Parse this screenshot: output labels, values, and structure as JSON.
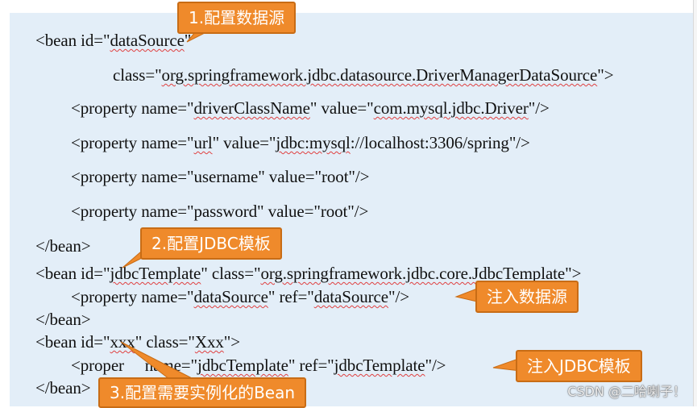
{
  "lines": [
    {
      "id": "l1",
      "segments": [
        {
          "t": "<bean id=\""
        },
        {
          "t": "dataSource",
          "sq": true
        },
        {
          "t": "\""
        }
      ]
    },
    {
      "id": "l2",
      "segments": [
        {
          "t": "class=\""
        },
        {
          "t": "org.springframework.jdbc.datasource.DriverManagerDataSource",
          "sq": true
        },
        {
          "t": "\">"
        }
      ]
    },
    {
      "id": "l3",
      "segments": [
        {
          "t": "<property name=\""
        },
        {
          "t": "driverClassName",
          "sq": true
        },
        {
          "t": "\" value=\""
        },
        {
          "t": "com.mysql.jdbc.Driver",
          "sq": true
        },
        {
          "t": "\"/>"
        }
      ]
    },
    {
      "id": "l4",
      "segments": [
        {
          "t": "<property name=\""
        },
        {
          "t": "url",
          "sq": true
        },
        {
          "t": "\" value=\""
        },
        {
          "t": "jdbc:mysql",
          "sq": true
        },
        {
          "t": "://localhost:3306/spring\"/>"
        }
      ]
    },
    {
      "id": "l5",
      "segments": [
        {
          "t": "<property name=\"username\" value=\"root\"/>"
        }
      ]
    },
    {
      "id": "l6",
      "segments": [
        {
          "t": "<property name=\"password\" value=\"root\"/>"
        }
      ]
    },
    {
      "id": "l7",
      "segments": [
        {
          "t": "</bean>"
        }
      ]
    },
    {
      "id": "l8",
      "segments": [
        {
          "t": "<bean id=\""
        },
        {
          "t": "jdbcTemplate",
          "sq": true
        },
        {
          "t": "\" class=\""
        },
        {
          "t": "org.springframework.jdbc.core.JdbcTemplate",
          "sq": true
        },
        {
          "t": "\">"
        }
      ]
    },
    {
      "id": "l9",
      "segments": [
        {
          "t": "<property name=\""
        },
        {
          "t": "dataSource",
          "sq": true
        },
        {
          "t": "\" ref=\""
        },
        {
          "t": "dataSource",
          "sq": true
        },
        {
          "t": "\"/>"
        }
      ]
    },
    {
      "id": "l10",
      "segments": [
        {
          "t": "</bean>"
        }
      ]
    },
    {
      "id": "l11",
      "segments": [
        {
          "t": "<bean id=\""
        },
        {
          "t": "xxx",
          "sq": true
        },
        {
          "t": "\" class=\""
        },
        {
          "t": "Xxx",
          "sq": true
        },
        {
          "t": "\">"
        }
      ]
    },
    {
      "id": "l12",
      "segments": [
        {
          "t": "<proper"
        },
        {
          "t": "     "
        },
        {
          "t": "name=\""
        },
        {
          "t": "jdbcTemplate",
          "sq": true
        },
        {
          "t": "\" ref=\""
        },
        {
          "t": "jdbcTemplate",
          "sq": true
        },
        {
          "t": "\"/>"
        }
      ]
    },
    {
      "id": "l13",
      "segments": [
        {
          "t": "</bean>"
        }
      ]
    }
  ],
  "callouts": {
    "c1": "1.配置数据源",
    "c2": "2.配置JDBC模板",
    "c3": "注入数据源",
    "c4": "注入JDBC模板",
    "c5": "3.配置需要实例化的Bean"
  },
  "watermark": "CSDN @二哈喇子！",
  "colors": {
    "callout_fill": "#ef8a2b",
    "panel": "#e3eef8",
    "squiggle": "#e04040"
  }
}
